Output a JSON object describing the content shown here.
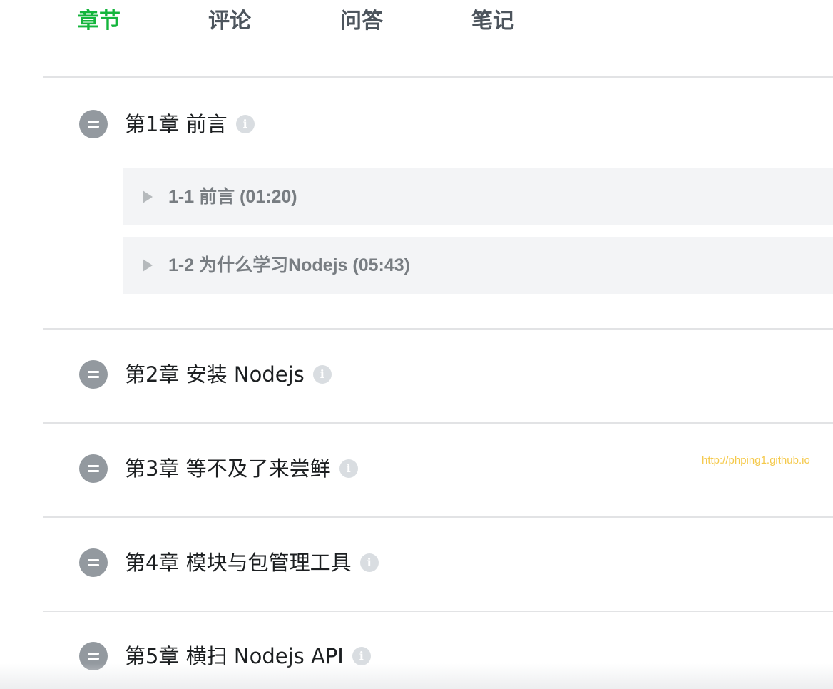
{
  "tabs": [
    {
      "label": "章节",
      "active": true
    },
    {
      "label": "评论",
      "active": false
    },
    {
      "label": "问答",
      "active": false
    },
    {
      "label": "笔记",
      "active": false
    }
  ],
  "chapters": [
    {
      "title": "第1章 前言",
      "info_icon": "info-icon",
      "sections": [
        {
          "title": "1-1 前言 (01:20)",
          "icon": "play-icon"
        },
        {
          "title": "1-2 为什么学习Nodejs (05:43)",
          "icon": "play-icon"
        }
      ]
    },
    {
      "title": "第2章 安装 Nodejs",
      "info_icon": "info-icon"
    },
    {
      "title": "第3章 等不及了来尝鲜",
      "info_icon": "info-icon"
    },
    {
      "title": "第4章 模块与包管理工具",
      "info_icon": "info-icon"
    },
    {
      "title": "第5章 横扫 Nodejs API",
      "info_icon": "info-icon"
    }
  ],
  "info_glyph": "i",
  "watermark": "http://phping1.github.io",
  "colors": {
    "accent": "#14b53c",
    "tab_inactive": "#4d555d",
    "toggle": "#93999f",
    "info": "#d9dde1",
    "section_bg": "#f3f4f6",
    "section_text": "#787d82",
    "watermark": "#f5c94a"
  }
}
